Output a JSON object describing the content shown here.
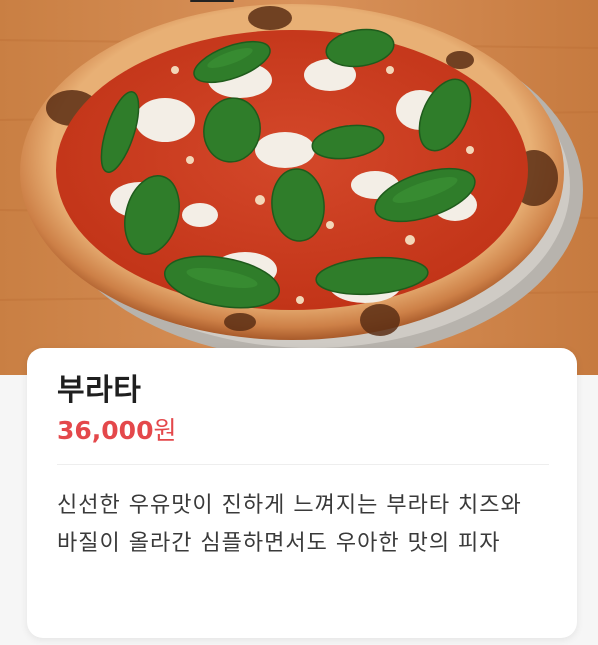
{
  "menu_item": {
    "image_alt": "부라타 피자",
    "name": "부라타",
    "price_amount": "36,000",
    "price_unit": "원",
    "description": "신선한 우유맛이 진하게 느껴지는 부라타 치즈와 바질이 올라간 심플하면서도 우아한 맛의 피자"
  },
  "colors": {
    "price": "#e4484b",
    "title": "#1f1f1f",
    "description": "#3a3a3a",
    "wood": "#d48a4c",
    "crust": "#c9773f",
    "sauce": "#cf3d22",
    "basil": "#2f7d2a"
  }
}
